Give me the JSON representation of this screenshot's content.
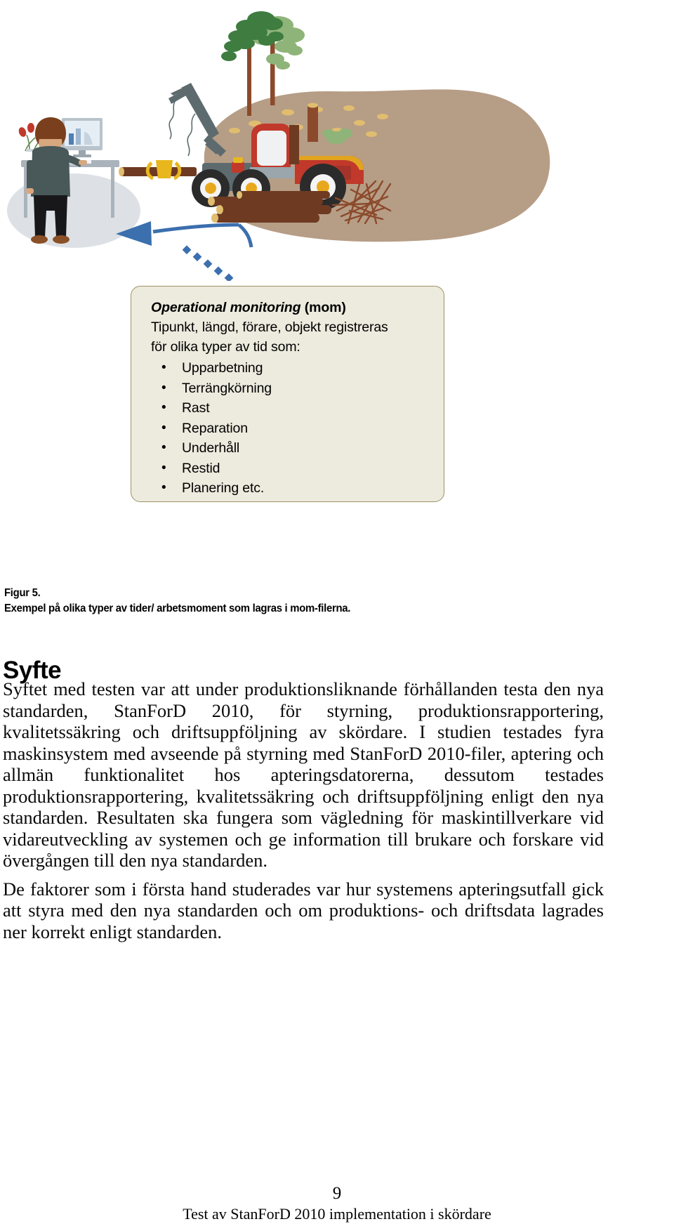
{
  "illustration": {
    "name": "forestry-workflow-illustration",
    "description": "Office worker at computer desk on the left, arrow pointing from forest harvesting scene on the right",
    "colors": {
      "ground_ellipse": "#b49a82",
      "arrow_blue": "#3b6fae",
      "machine_red": "#c0392b",
      "machine_dark": "#5d6b6e",
      "tree_green_dark": "#3d7a3f",
      "tree_green_light": "#86b074",
      "trunk_brown": "#8a4a2a",
      "log_brown": "#6e3a22",
      "log_end": "#e0c27a",
      "floor_grey": "#dfe2e6",
      "desk_grey": "#a4adb6",
      "jacket_grey": "#49595a",
      "hair_brown": "#7a3f1d",
      "wheel_hub": "#e8a81e"
    },
    "elements": [
      "office-worker",
      "desk",
      "monitor",
      "bar-chart-on-screen",
      "flower-vase",
      "harvester-machine",
      "crane-arm",
      "harvester-head",
      "pine-trees",
      "stumps",
      "log-pile",
      "brushwood-pile",
      "blue-arrow",
      "dotted-line"
    ]
  },
  "callout": {
    "title_emphasis": "Operational monitoring",
    "title_rest": " (mom)",
    "line1": "Tipunkt, längd, förare, objekt registreras",
    "line2": "för olika typer av tid som:",
    "bullet_char": "•",
    "items": [
      "Upparbetning",
      "Terrängkörning",
      "Rast",
      "Reparation",
      "Underhåll",
      "Restid",
      "Planering etc."
    ]
  },
  "figure_caption": {
    "label": "Figur 5.",
    "text": "Exempel på olika typer av tider/ arbetsmoment som lagras i mom-filerna."
  },
  "section": {
    "heading": "Syfte",
    "paragraphs": [
      "Syftet med testen var att under produktionsliknande förhållanden testa den nya standarden, StanForD 2010, för styrning, produktionsrapportering, kvalitetssäkring och driftsuppföljning av skördare. I studien testades fyra maskinsystem med avseende på styrning med StanForD 2010-filer, aptering och allmän funktionalitet hos apteringsdatorerna, dessutom testades produktionsrapportering, kvalitetssäkring och driftsuppföljning enligt den nya standarden.  Resultaten ska fungera som vägledning för maskintillverkare vid vidareutveckling av systemen och ge information till brukare och forskare vid övergången till den nya standarden.",
      "De faktorer som i första hand studerades var hur systemens apteringsutfall gick att styra med den nya standarden och om produktions- och driftsdata lagrades ner korrekt enligt standarden."
    ]
  },
  "footer": {
    "page_number": "9",
    "title": "Test av StanForD 2010 implementation i skördare"
  }
}
